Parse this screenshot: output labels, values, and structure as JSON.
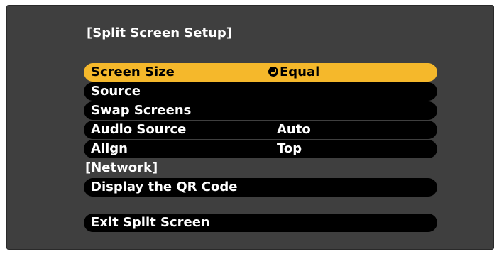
{
  "window": {
    "title": "[Split Screen Setup]"
  },
  "menu": {
    "items": [
      {
        "label": "Screen Size",
        "value": "Equal",
        "enter_icon": "enter-icon",
        "selected": true
      },
      {
        "label": "Source",
        "value": ""
      },
      {
        "label": "Swap Screens",
        "value": ""
      },
      {
        "label": "Audio Source",
        "value": "Auto"
      },
      {
        "label": "Align",
        "value": "Top"
      }
    ],
    "network_section": "[Network]",
    "network_items": [
      {
        "label": "Display the QR Code"
      }
    ],
    "exit": {
      "label": "Exit Split Screen"
    }
  },
  "colors": {
    "background": "#3f3f3f",
    "highlight": "#f5b82b",
    "pill": "#000000",
    "text": "#ffffff"
  }
}
